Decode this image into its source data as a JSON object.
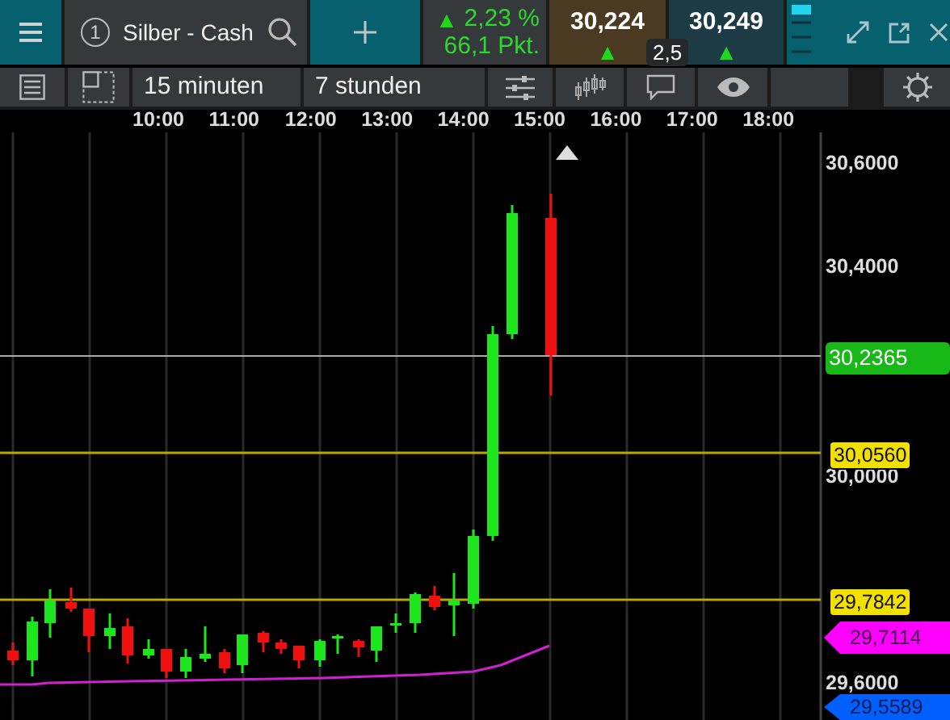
{
  "header": {
    "instrument_number": "1",
    "instrument": "Silber - Cash",
    "change_percent": "2,23 %",
    "change_points": "66,1 Pkt.",
    "arrow": "▲",
    "sell": {
      "price": "30,224",
      "arrow": "▲"
    },
    "buy": {
      "price": "30,249",
      "arrow": "▲"
    },
    "spread": "2,5"
  },
  "toolbar": {
    "interval": "15 minuten",
    "range": "7 stunden"
  },
  "time_axis": [
    "10:00",
    "11:00",
    "12:00",
    "13:00",
    "14:00",
    "15:00",
    "16:00",
    "17:00",
    "18:00"
  ],
  "price_axis": [
    "30,6000",
    "30,4000",
    "30,0000",
    "29,6000"
  ],
  "price_tags": [
    {
      "text": "30,2365",
      "kind": "tag",
      "color": "#17b817"
    },
    {
      "text": "30,0560",
      "kind": "tag",
      "color": "#f2e000"
    },
    {
      "text": "29,7842",
      "kind": "tag",
      "color": "#f2e000"
    },
    {
      "text": "29,7114",
      "kind": "pointer",
      "color": "#ff00ff"
    },
    {
      "text": "29,5589",
      "kind": "pointer",
      "color": "#0060ff"
    }
  ]
}
